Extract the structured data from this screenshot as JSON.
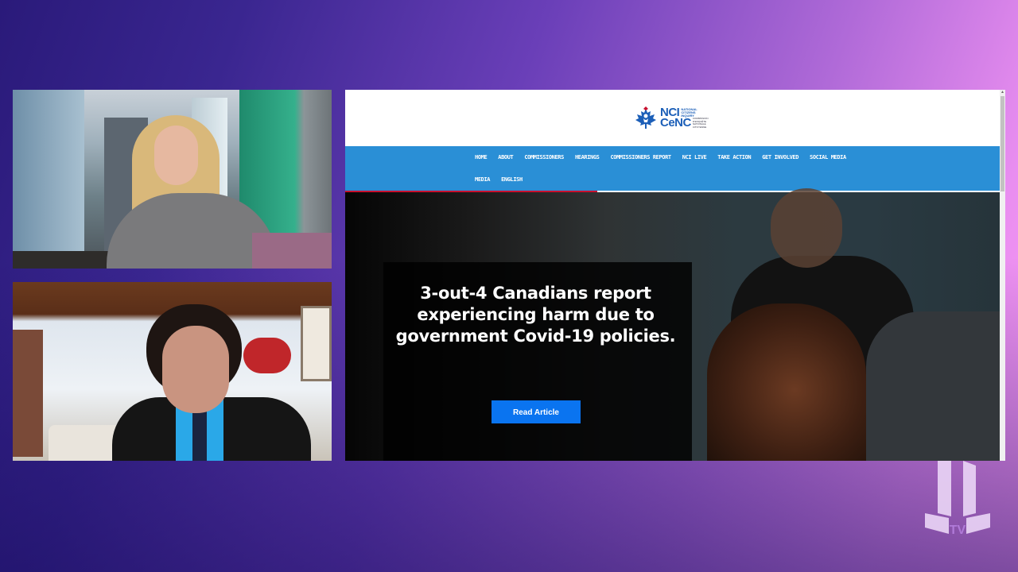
{
  "stream": {
    "panels": [
      {
        "role": "host",
        "description": "Host seated at desk in front of city skyline"
      },
      {
        "role": "guest",
        "description": "Guest in suit on video call from living room"
      }
    ],
    "channel_logo": "TV"
  },
  "browser": {
    "site": {
      "logo": {
        "mark": "maple-leaf-icon",
        "line1": "NCI",
        "line1_sub": "NATIONAL CITIZENS INQUIRY",
        "line2": "CeNC",
        "line2_sub": "COMMISSION D'ENQUÊTE NATIONALE CITOYENNE"
      },
      "nav": {
        "row1": [
          "HOME",
          "ABOUT",
          "COMMISSIONERS",
          "HEARINGS",
          "COMMISSIONERS REPORT",
          "NCI LIVE",
          "TAKE ACTION",
          "GET INVOLVED",
          "SOCIAL MEDIA"
        ],
        "row2": [
          "MEDIA",
          "ENGLISH"
        ]
      },
      "hero": {
        "headline": "3-out-4 Canadians report experiencing harm due to government Covid-19 policies.",
        "button_label": "Read Article"
      }
    },
    "colors": {
      "nav_bg": "#2a8fd6",
      "accent_red": "#c8102e",
      "button_blue": "#0a74f0",
      "logo_blue": "#1c5fb8"
    }
  }
}
